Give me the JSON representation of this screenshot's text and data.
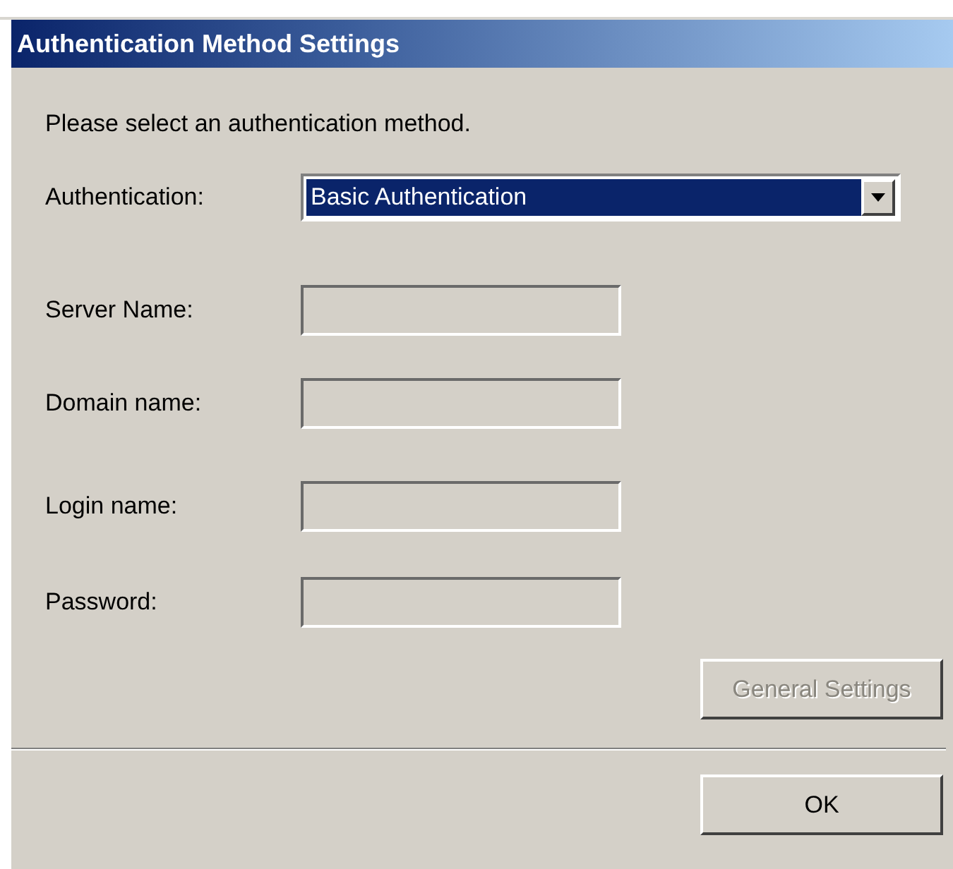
{
  "window": {
    "title": "Authentication Method Settings"
  },
  "instruction": "Please select an authentication method.",
  "authentication": {
    "label": "Authentication:",
    "value": "Basic Authentication",
    "selected": true
  },
  "fields": [
    {
      "label": "Server Name:",
      "disabled": true
    },
    {
      "label": "Domain name:",
      "disabled": true
    },
    {
      "label": "Login name:",
      "disabled": true
    },
    {
      "label": "Password:",
      "disabled": true
    }
  ],
  "buttons": [
    {
      "label": "General Settings",
      "disabled": true
    },
    {
      "label": "OK",
      "disabled": false
    }
  ]
}
